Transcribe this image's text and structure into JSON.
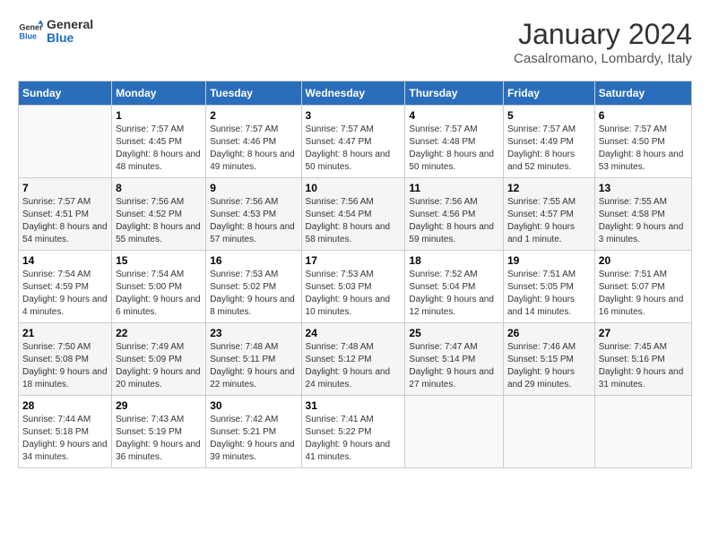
{
  "logo": {
    "line1": "General",
    "line2": "Blue"
  },
  "title": "January 2024",
  "location": "Casalromano, Lombardy, Italy",
  "days_header": [
    "Sunday",
    "Monday",
    "Tuesday",
    "Wednesday",
    "Thursday",
    "Friday",
    "Saturday"
  ],
  "weeks": [
    [
      {
        "day": "",
        "sunrise": "",
        "sunset": "",
        "daylight": ""
      },
      {
        "day": "1",
        "sunrise": "Sunrise: 7:57 AM",
        "sunset": "Sunset: 4:45 PM",
        "daylight": "Daylight: 8 hours and 48 minutes."
      },
      {
        "day": "2",
        "sunrise": "Sunrise: 7:57 AM",
        "sunset": "Sunset: 4:46 PM",
        "daylight": "Daylight: 8 hours and 49 minutes."
      },
      {
        "day": "3",
        "sunrise": "Sunrise: 7:57 AM",
        "sunset": "Sunset: 4:47 PM",
        "daylight": "Daylight: 8 hours and 50 minutes."
      },
      {
        "day": "4",
        "sunrise": "Sunrise: 7:57 AM",
        "sunset": "Sunset: 4:48 PM",
        "daylight": "Daylight: 8 hours and 50 minutes."
      },
      {
        "day": "5",
        "sunrise": "Sunrise: 7:57 AM",
        "sunset": "Sunset: 4:49 PM",
        "daylight": "Daylight: 8 hours and 52 minutes."
      },
      {
        "day": "6",
        "sunrise": "Sunrise: 7:57 AM",
        "sunset": "Sunset: 4:50 PM",
        "daylight": "Daylight: 8 hours and 53 minutes."
      }
    ],
    [
      {
        "day": "7",
        "sunrise": "Sunrise: 7:57 AM",
        "sunset": "Sunset: 4:51 PM",
        "daylight": "Daylight: 8 hours and 54 minutes."
      },
      {
        "day": "8",
        "sunrise": "Sunrise: 7:56 AM",
        "sunset": "Sunset: 4:52 PM",
        "daylight": "Daylight: 8 hours and 55 minutes."
      },
      {
        "day": "9",
        "sunrise": "Sunrise: 7:56 AM",
        "sunset": "Sunset: 4:53 PM",
        "daylight": "Daylight: 8 hours and 57 minutes."
      },
      {
        "day": "10",
        "sunrise": "Sunrise: 7:56 AM",
        "sunset": "Sunset: 4:54 PM",
        "daylight": "Daylight: 8 hours and 58 minutes."
      },
      {
        "day": "11",
        "sunrise": "Sunrise: 7:56 AM",
        "sunset": "Sunset: 4:56 PM",
        "daylight": "Daylight: 8 hours and 59 minutes."
      },
      {
        "day": "12",
        "sunrise": "Sunrise: 7:55 AM",
        "sunset": "Sunset: 4:57 PM",
        "daylight": "Daylight: 9 hours and 1 minute."
      },
      {
        "day": "13",
        "sunrise": "Sunrise: 7:55 AM",
        "sunset": "Sunset: 4:58 PM",
        "daylight": "Daylight: 9 hours and 3 minutes."
      }
    ],
    [
      {
        "day": "14",
        "sunrise": "Sunrise: 7:54 AM",
        "sunset": "Sunset: 4:59 PM",
        "daylight": "Daylight: 9 hours and 4 minutes."
      },
      {
        "day": "15",
        "sunrise": "Sunrise: 7:54 AM",
        "sunset": "Sunset: 5:00 PM",
        "daylight": "Daylight: 9 hours and 6 minutes."
      },
      {
        "day": "16",
        "sunrise": "Sunrise: 7:53 AM",
        "sunset": "Sunset: 5:02 PM",
        "daylight": "Daylight: 9 hours and 8 minutes."
      },
      {
        "day": "17",
        "sunrise": "Sunrise: 7:53 AM",
        "sunset": "Sunset: 5:03 PM",
        "daylight": "Daylight: 9 hours and 10 minutes."
      },
      {
        "day": "18",
        "sunrise": "Sunrise: 7:52 AM",
        "sunset": "Sunset: 5:04 PM",
        "daylight": "Daylight: 9 hours and 12 minutes."
      },
      {
        "day": "19",
        "sunrise": "Sunrise: 7:51 AM",
        "sunset": "Sunset: 5:05 PM",
        "daylight": "Daylight: 9 hours and 14 minutes."
      },
      {
        "day": "20",
        "sunrise": "Sunrise: 7:51 AM",
        "sunset": "Sunset: 5:07 PM",
        "daylight": "Daylight: 9 hours and 16 minutes."
      }
    ],
    [
      {
        "day": "21",
        "sunrise": "Sunrise: 7:50 AM",
        "sunset": "Sunset: 5:08 PM",
        "daylight": "Daylight: 9 hours and 18 minutes."
      },
      {
        "day": "22",
        "sunrise": "Sunrise: 7:49 AM",
        "sunset": "Sunset: 5:09 PM",
        "daylight": "Daylight: 9 hours and 20 minutes."
      },
      {
        "day": "23",
        "sunrise": "Sunrise: 7:48 AM",
        "sunset": "Sunset: 5:11 PM",
        "daylight": "Daylight: 9 hours and 22 minutes."
      },
      {
        "day": "24",
        "sunrise": "Sunrise: 7:48 AM",
        "sunset": "Sunset: 5:12 PM",
        "daylight": "Daylight: 9 hours and 24 minutes."
      },
      {
        "day": "25",
        "sunrise": "Sunrise: 7:47 AM",
        "sunset": "Sunset: 5:14 PM",
        "daylight": "Daylight: 9 hours and 27 minutes."
      },
      {
        "day": "26",
        "sunrise": "Sunrise: 7:46 AM",
        "sunset": "Sunset: 5:15 PM",
        "daylight": "Daylight: 9 hours and 29 minutes."
      },
      {
        "day": "27",
        "sunrise": "Sunrise: 7:45 AM",
        "sunset": "Sunset: 5:16 PM",
        "daylight": "Daylight: 9 hours and 31 minutes."
      }
    ],
    [
      {
        "day": "28",
        "sunrise": "Sunrise: 7:44 AM",
        "sunset": "Sunset: 5:18 PM",
        "daylight": "Daylight: 9 hours and 34 minutes."
      },
      {
        "day": "29",
        "sunrise": "Sunrise: 7:43 AM",
        "sunset": "Sunset: 5:19 PM",
        "daylight": "Daylight: 9 hours and 36 minutes."
      },
      {
        "day": "30",
        "sunrise": "Sunrise: 7:42 AM",
        "sunset": "Sunset: 5:21 PM",
        "daylight": "Daylight: 9 hours and 39 minutes."
      },
      {
        "day": "31",
        "sunrise": "Sunrise: 7:41 AM",
        "sunset": "Sunset: 5:22 PM",
        "daylight": "Daylight: 9 hours and 41 minutes."
      },
      {
        "day": "",
        "sunrise": "",
        "sunset": "",
        "daylight": ""
      },
      {
        "day": "",
        "sunrise": "",
        "sunset": "",
        "daylight": ""
      },
      {
        "day": "",
        "sunrise": "",
        "sunset": "",
        "daylight": ""
      }
    ]
  ]
}
